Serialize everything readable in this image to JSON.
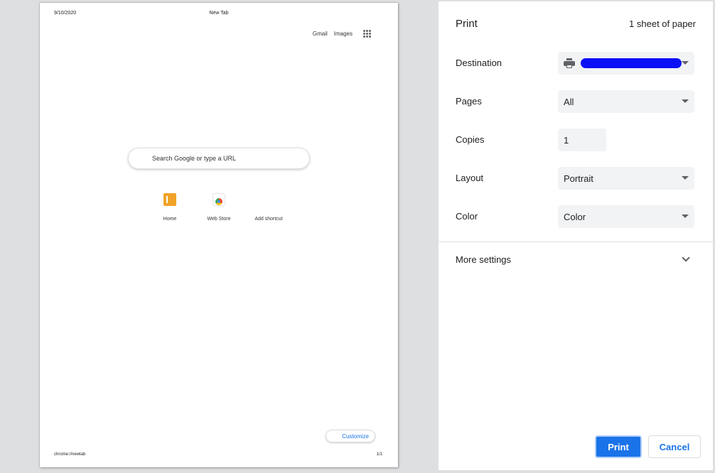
{
  "preview": {
    "header_date": "9/10/2020",
    "header_title": "New Tab",
    "links": [
      "Gmail",
      "Images"
    ],
    "apps_icon": "apps-grid-icon",
    "search_placeholder": "Search Google or type a URL",
    "shortcuts": [
      {
        "label": "Home",
        "icon": "home-shortcut-icon"
      },
      {
        "label": "Web Store",
        "icon": "web-store-icon"
      },
      {
        "label": "Add shortcut"
      }
    ],
    "customize_label": "Customize",
    "footer_url": "chrome://newtab",
    "footer_page": "1/1"
  },
  "panel": {
    "title": "Print",
    "sheets": "1 sheet of paper",
    "destination": {
      "label": "Destination",
      "value": ""
    },
    "pages": {
      "label": "Pages",
      "value": "All"
    },
    "copies": {
      "label": "Copies",
      "value": "1"
    },
    "layout": {
      "label": "Layout",
      "value": "Portrait"
    },
    "color": {
      "label": "Color",
      "value": "Color"
    },
    "more_settings": "More settings",
    "print_button": "Print",
    "cancel_button": "Cancel"
  },
  "colors": {
    "accent": "#1a73e8",
    "redaction": "#0a0ff5"
  }
}
